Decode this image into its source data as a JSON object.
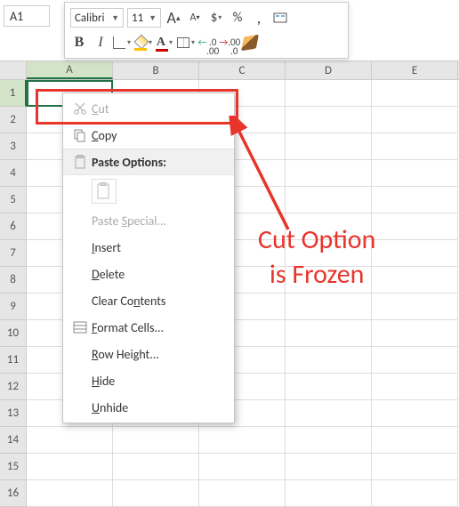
{
  "nameBox": "A1",
  "toolbar": {
    "font": "Calibri",
    "size": "11",
    "increaseFont": "A",
    "decreaseFont": "A",
    "currency": "$",
    "percent": "%",
    "comma": ",",
    "bold": "B",
    "italic": "I",
    "fontColor": "A",
    "decInc": ".0\n.00",
    "decDec": ".00\n.0"
  },
  "columns": [
    "A",
    "B",
    "C",
    "D",
    "E"
  ],
  "rows": [
    "1",
    "2",
    "3",
    "4",
    "5",
    "6",
    "7",
    "8",
    "9",
    "10",
    "11",
    "12",
    "13",
    "14",
    "15",
    "16"
  ],
  "activeCell": "A1",
  "contextMenu": {
    "cut": "Cut",
    "copy": "Copy",
    "pasteOptions": "Paste Options:",
    "pasteSpecial": "Paste Special...",
    "insert": "Insert",
    "delete": "Delete",
    "clearContents": "Clear Contents",
    "formatCells": "Format Cells...",
    "rowHeight": "Row Height...",
    "hide": "Hide",
    "unhide": "Unhide"
  },
  "annotation": {
    "line1": "Cut Option",
    "line2": "is Frozen"
  }
}
